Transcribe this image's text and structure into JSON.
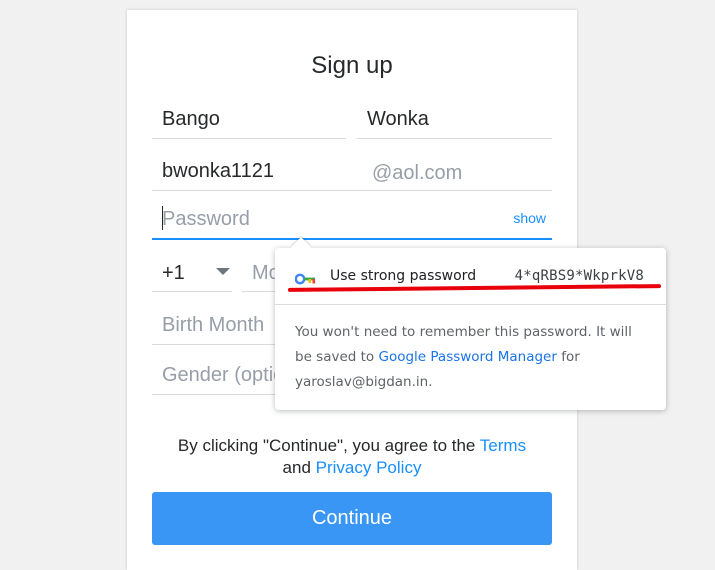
{
  "form": {
    "title": "Sign up",
    "first_name": "Bango",
    "last_name": "Wonka",
    "username": "bwonka1121",
    "domain_suffix": "@aol.com",
    "password_placeholder": "Password",
    "show_label": "show",
    "country_code": "+1",
    "mobile_placeholder": "Mo",
    "birth_month_placeholder": "Birth Month",
    "gender_placeholder": "Gender (optio",
    "legal_prefix": "By clicking \"Continue\", you agree to the ",
    "terms_link": "Terms",
    "legal_and": "and ",
    "privacy_link": "Privacy Policy",
    "continue_label": "Continue"
  },
  "password_popup": {
    "suggest_label": "Use strong password",
    "suggested_password": "4*qRBS9*WkprkV8",
    "info_part1": "You won't need to remember this password. It will be saved to ",
    "manager_link": "Google Password Manager",
    "info_part2": " for yaroslav@bigdan.in.",
    "icon": "key-icon",
    "annotation_color": "#e8000b"
  },
  "colors": {
    "accent": "#188fff",
    "button": "#3996f5"
  }
}
